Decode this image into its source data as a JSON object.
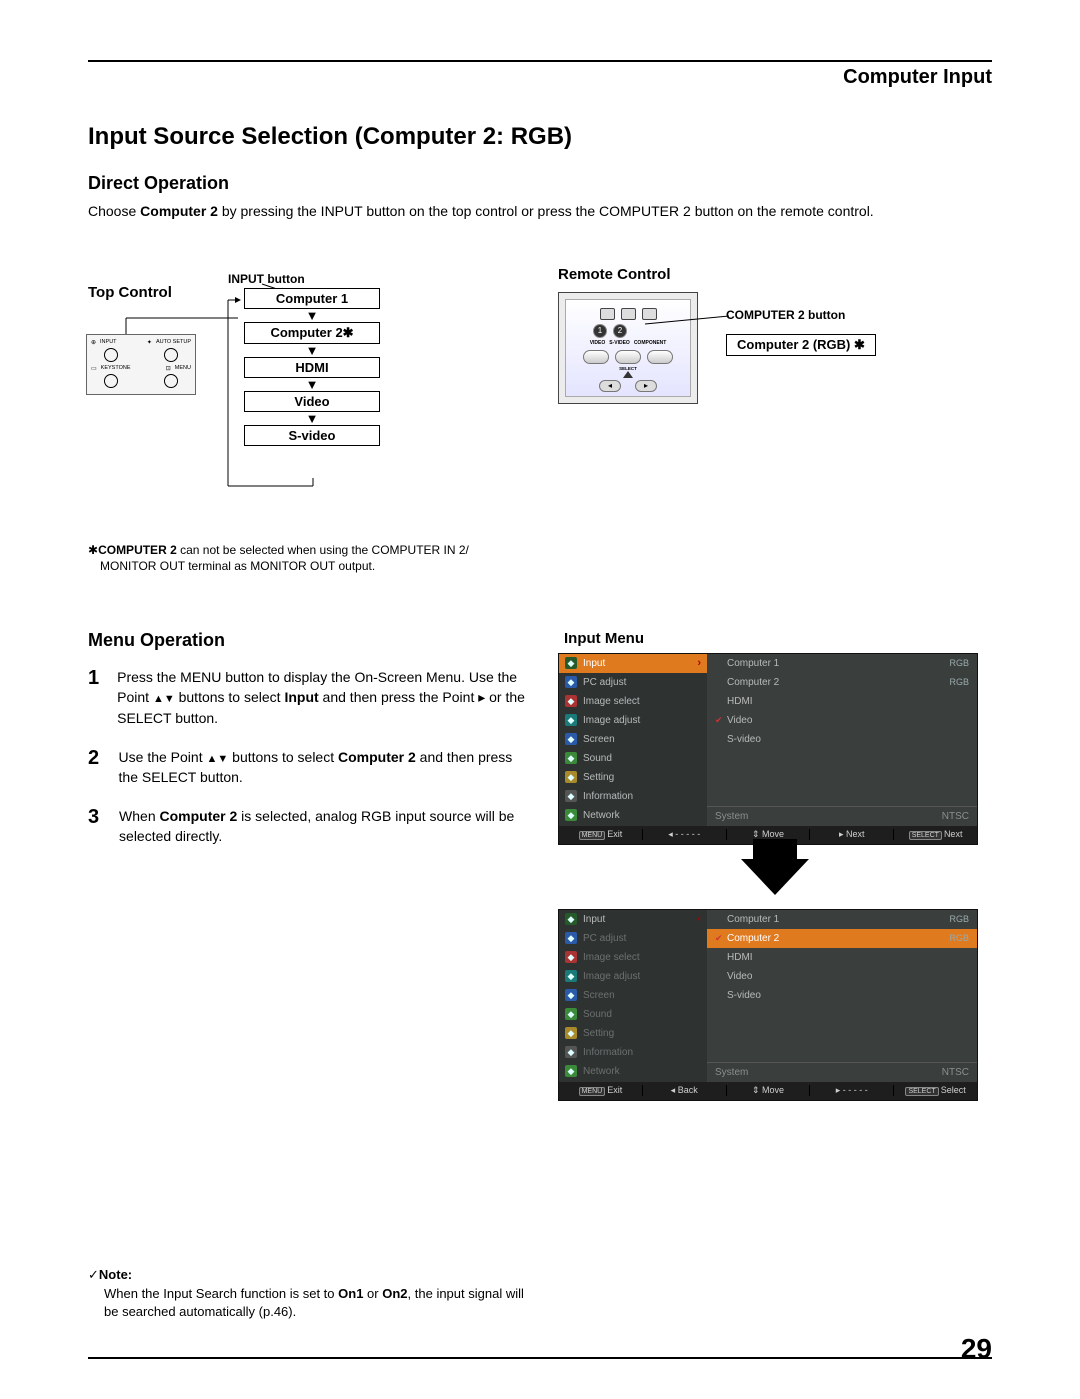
{
  "header": {
    "section": "Computer Input"
  },
  "title": "Input Source Selection (Computer 2: RGB)",
  "direct": {
    "heading": "Direct Operation",
    "intro_pre": "Choose ",
    "intro_bold": "Computer 2",
    "intro_post": " by pressing the INPUT button on the top control or press the COMPUTER 2 button on the remote control."
  },
  "top_control": {
    "title": "Top Control",
    "input_button_label": "INPUT button",
    "panel": {
      "row1": {
        "sym1": "⊕",
        "l1": "INPUT",
        "sym2": "✦",
        "l2": "AUTO SETUP"
      },
      "row2": {
        "sym1": "▭",
        "l1": "KEYSTONE",
        "sym2": "⊡",
        "l2": "MENU"
      }
    },
    "flow": [
      "Computer 1",
      "Computer 2✱",
      "HDMI",
      "Video",
      "S-video"
    ]
  },
  "remote": {
    "title": "Remote Control",
    "c2_button_label": "COMPUTER 2 button",
    "c2_box": "Computer 2 (RGB)  ✱",
    "mini_labels": [
      "VIDEO",
      "S-VIDEO",
      "COMPONENT"
    ],
    "select": "SELECT"
  },
  "star_note": {
    "line1_pre": "✱",
    "line1_bold": "COMPUTER 2",
    "line1_post": " can not be selected when using the COMPUTER IN 2/",
    "line2": "MONITOR OUT terminal as MONITOR OUT output."
  },
  "menu_op": {
    "heading": "Menu Operation",
    "steps": [
      {
        "n": "1",
        "pre": "Press the MENU button to display the On-Screen Menu. Use the Point ",
        "tri": "▲▼",
        "mid": " buttons to select ",
        "bold": "Input",
        "post": " and then press the Point ▸ or the SELECT button."
      },
      {
        "n": "2",
        "pre": "Use the Point ",
        "tri": "▲▼",
        "mid": " buttons to select ",
        "bold": "Computer 2",
        "post": " and then press the SELECT button."
      },
      {
        "n": "3",
        "pre": "When ",
        "bold": "Computer 2",
        "post": " is selected, analog RGB input source will be selected directly."
      }
    ]
  },
  "osd": {
    "title": "Input Menu",
    "left_items": [
      {
        "label": "Input",
        "sel": true
      },
      {
        "label": "PC adjust"
      },
      {
        "label": "Image select"
      },
      {
        "label": "Image adjust"
      },
      {
        "label": "Screen"
      },
      {
        "label": "Sound"
      },
      {
        "label": "Setting"
      },
      {
        "label": "Information"
      },
      {
        "label": "Network"
      }
    ],
    "panel1_right": [
      {
        "name": "Computer 1",
        "val": "RGB"
      },
      {
        "name": "Computer 2",
        "val": "RGB"
      },
      {
        "name": "HDMI",
        "val": ""
      },
      {
        "name": "Video",
        "val": "",
        "chk": true
      },
      {
        "name": "S-video",
        "val": ""
      }
    ],
    "panel2_right": [
      {
        "name": "Computer 1",
        "val": "RGB"
      },
      {
        "name": "Computer 2",
        "val": "RGB",
        "sel": true,
        "chk": true
      },
      {
        "name": "HDMI",
        "val": ""
      },
      {
        "name": "Video",
        "val": ""
      },
      {
        "name": "S-video",
        "val": ""
      }
    ],
    "system_row": {
      "label": "System",
      "val": "NTSC"
    },
    "footer1": [
      {
        "key": "MENU",
        "txt": "Exit"
      },
      {
        "key": "",
        "txt": "◂ - - - - -"
      },
      {
        "key": "",
        "txt": "⇕ Move"
      },
      {
        "key": "",
        "txt": "▸ Next"
      },
      {
        "key": "SELECT",
        "txt": "Next"
      }
    ],
    "footer2": [
      {
        "key": "MENU",
        "txt": "Exit"
      },
      {
        "key": "",
        "txt": "◂ Back"
      },
      {
        "key": "",
        "txt": "⇕ Move"
      },
      {
        "key": "",
        "txt": "▸ - - - - -"
      },
      {
        "key": "SELECT",
        "txt": "Select"
      }
    ]
  },
  "foot_note": {
    "check": "✓",
    "title": "Note:",
    "l1_pre": "When the Input Search function is set to ",
    "b1": "On1",
    "mid": " or ",
    "b2": "On2",
    "l1_post": ", the input signal will be searched automatically (p.46)."
  },
  "page_number": "29"
}
